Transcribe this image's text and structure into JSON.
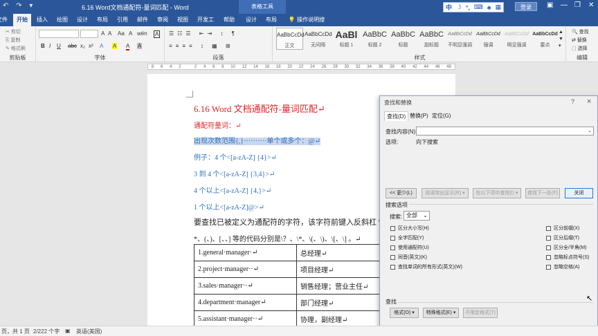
{
  "window": {
    "title": "6.16 Word文档通配符-量词匹配  -  Word",
    "context_tab": "表格工具",
    "login": "登录",
    "ime": [
      "中",
      "☽",
      "°,",
      "⌨",
      "♣",
      "▦"
    ]
  },
  "tabs": [
    "文件",
    "开始",
    "插入",
    "绘图",
    "设计",
    "布局",
    "引用",
    "邮件",
    "审阅",
    "视图",
    "开发工具",
    "帮助",
    "设计",
    "布局",
    "操作说明搜索"
  ],
  "ribbon": {
    "clipboard": {
      "items": [
        "剪切",
        "复制",
        "格式刷"
      ],
      "label": "剪贴板"
    },
    "font": {
      "label": "字体",
      "buttons": [
        "A",
        "A",
        "Aa",
        "A",
        "wén",
        "A"
      ],
      "format": [
        "B",
        "I",
        "U",
        "abc",
        "x₂",
        "x²",
        "A",
        "A",
        "A",
        "A"
      ]
    },
    "paragraph": {
      "label": "段落"
    },
    "styles": {
      "label": "样式",
      "items": [
        {
          "preview": "AaBbCcDd",
          "name": "正文"
        },
        {
          "preview": "AaBbCcDd",
          "name": "无间隔"
        },
        {
          "preview": "AaBl",
          "name": "标题 1"
        },
        {
          "preview": "AaBbC",
          "name": "标题 2"
        },
        {
          "preview": "AaBbC",
          "name": "标题"
        },
        {
          "preview": "AaBbC",
          "name": "副标题"
        },
        {
          "preview": "AaBbCcDd",
          "name": "不明显强调"
        },
        {
          "preview": "AaBbCcDd",
          "name": "强调"
        },
        {
          "preview": "AaBbCcDd",
          "name": "明显强调"
        },
        {
          "preview": "AaBbCcDd",
          "name": "要点"
        }
      ]
    },
    "editing": {
      "label": "编辑",
      "items": [
        "查找",
        "替换",
        "选择"
      ]
    }
  },
  "ruler": [
    "8",
    "6",
    "4",
    "2",
    "",
    "2",
    "4",
    "6",
    "8",
    "10",
    "12",
    "14",
    "16",
    "18",
    "20",
    "22",
    "24",
    "26",
    "28",
    "30",
    "32",
    "34",
    "36",
    "38",
    "40",
    "42",
    "44",
    "46",
    "48"
  ],
  "document": {
    "title": "6.16 Word 文档通配符-量词匹配↵",
    "subtitle": "通配符量词：↵",
    "line1": "出现次数范围{,}··········单个或多个：@↵",
    "ex1": "例子：4 个<[a-zA-Z] {4}>↵",
    "ex2": "3 到 4 个<[a-zA-Z] {3,4}>↵",
    "ex3": "4 个以上<[a-zA-Z] {4,}>↵",
    "ex4": "1 个以上<[a-zA-Z]@>↵",
    "para1": "要查找已被定义为通配符的字符，该字符前键入反斜杠 \\ .",
    "para2": "*、(、)、[、、] 等的代码分别是\\？、\\*、\\(、\\)、\\[、\\] 。↵",
    "table": [
      [
        "1.general·manager·↵",
        "总经理↵"
      ],
      [
        "2.project·manager··↵",
        "项目经理↵"
      ],
      [
        "3.sales·manager··↵",
        "销售经理；营业主任↵"
      ],
      [
        "4.department·manager↵",
        "部门经理↵"
      ],
      [
        "5.assistant·manager··↵",
        "协理，副经理↵"
      ]
    ]
  },
  "dialog": {
    "title": "查找和替换",
    "help": "?",
    "close": "×",
    "tabs": [
      "查找(D)",
      "替换(P)",
      "定位(G)"
    ],
    "find_label": "查找内容(N):",
    "find_value": "",
    "options_label": "选项:",
    "options_value": "向下搜索",
    "buttons": {
      "less": "<< 更少(L)",
      "highlight": "阅读突出显示(R) ▾",
      "find_in": "在以下项中查找(I) ▾",
      "find_next": "查找下一处(F)",
      "close": "关闭"
    },
    "search_options_title": "搜索选项",
    "search_label": "搜索:",
    "search_value": "全部",
    "left_options": [
      "区分大小写(H)",
      "全字匹配(Y)",
      "使用通配符(U)",
      "同音(英文)(K)",
      "查找单词的所有形式(英文)(W)"
    ],
    "right_options": [
      "区分前缀(X)",
      "区分后缀(T)",
      "区分全/半角(M)",
      "忽略标点符号(S)",
      "忽略空格(A)"
    ],
    "find_section": "查找",
    "format_btn": "格式(O) ▾",
    "special_btn": "特殊格式(E) ▾",
    "noformat_btn": "不限定格式(T)"
  },
  "statusbar": {
    "page": "页，共 1 页",
    "words": "2/222 个字",
    "lang": "英语(美国)"
  }
}
